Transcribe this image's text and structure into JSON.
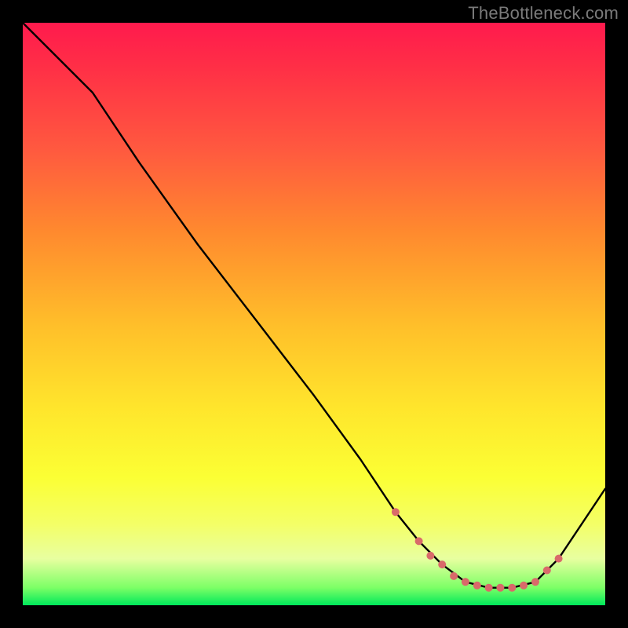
{
  "watermark": "TheBottleneck.com",
  "chart_data": {
    "type": "line",
    "title": "",
    "xlabel": "",
    "ylabel": "",
    "xlim": [
      0,
      100
    ],
    "ylim": [
      0,
      100
    ],
    "series": [
      {
        "name": "curve",
        "x": [
          0,
          6,
          12,
          20,
          30,
          40,
          50,
          58,
          64,
          68,
          72,
          76,
          80,
          84,
          88,
          92,
          100
        ],
        "values": [
          100,
          94,
          88,
          76,
          62,
          49,
          36,
          25,
          16,
          11,
          7,
          4,
          3,
          3,
          4,
          8,
          20
        ]
      }
    ],
    "markers": {
      "name": "dots",
      "color": "#d96a6a",
      "x": [
        64,
        68,
        70,
        72,
        74,
        76,
        78,
        80,
        82,
        84,
        86,
        88,
        90,
        92
      ],
      "values": [
        16,
        11,
        8.5,
        7,
        5,
        4,
        3.4,
        3,
        3,
        3,
        3.4,
        4,
        6,
        8
      ]
    }
  },
  "colors": {
    "line": "#000000",
    "marker": "#d96a6a"
  }
}
